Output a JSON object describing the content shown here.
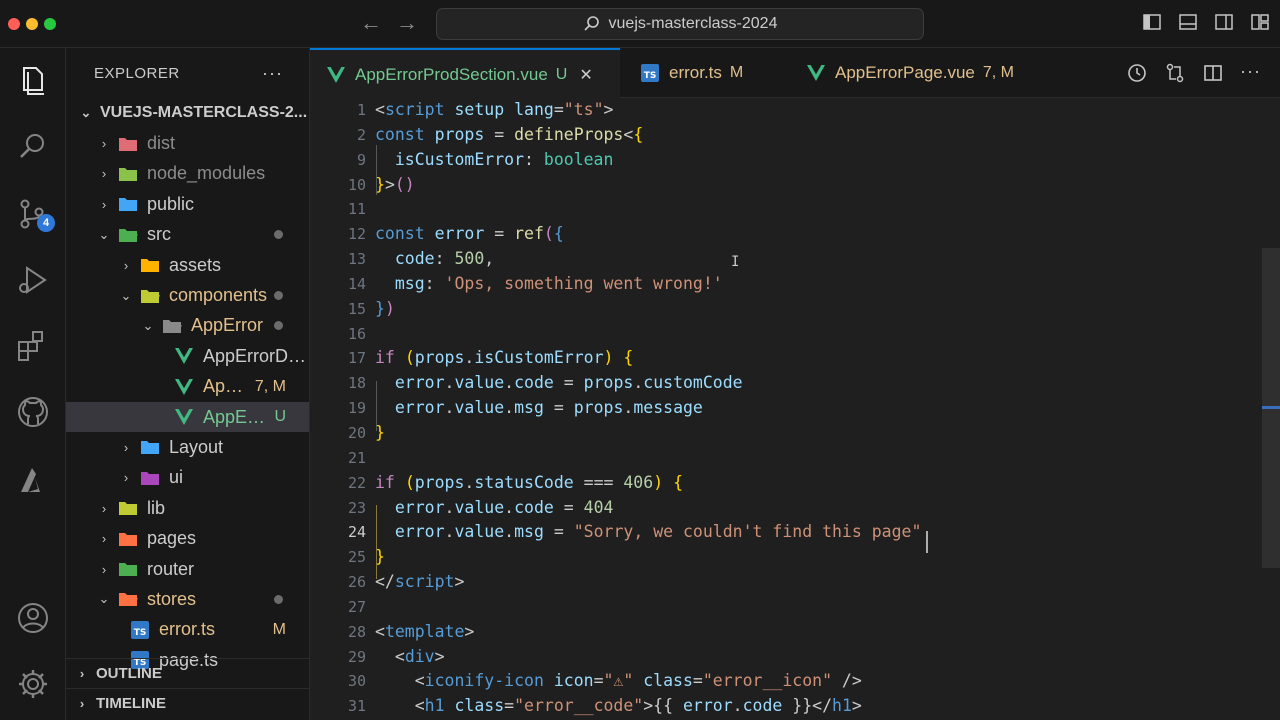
{
  "window": {
    "search_text": "vuejs-masterclass-2024",
    "traffic_colors": [
      "#ff5f57",
      "#febc2e",
      "#28c840"
    ]
  },
  "activity_bar": {
    "items": [
      "explorer-icon",
      "search-icon",
      "source-control-icon",
      "run-debug-icon",
      "extensions-icon",
      "github-icon",
      "azure-icon"
    ],
    "source_control_badge": "4",
    "bottom": [
      "account-icon",
      "settings-gear-icon"
    ]
  },
  "sidebar": {
    "title": "EXPLORER",
    "more": "···",
    "root": "VUEJS-MASTERCLASS-2...",
    "items": [
      {
        "label": "dist",
        "depth": 1,
        "kind": "folder",
        "open": false,
        "color": "#e06c75",
        "dim": true
      },
      {
        "label": "node_modules",
        "depth": 1,
        "kind": "folder",
        "open": false,
        "color": "#8bc34a",
        "dim": true
      },
      {
        "label": "public",
        "depth": 1,
        "kind": "folder",
        "open": false,
        "color": "#42a5f5"
      },
      {
        "label": "src",
        "depth": 1,
        "kind": "folder",
        "open": true,
        "color": "#4caf50",
        "dot": true
      },
      {
        "label": "assets",
        "depth": 2,
        "kind": "folder",
        "open": false,
        "color": "#ffb300"
      },
      {
        "label": "components",
        "depth": 2,
        "kind": "folder",
        "open": true,
        "color": "#c0ca33",
        "dot": true,
        "accent": "#e2c08d"
      },
      {
        "label": "AppError",
        "depth": 3,
        "kind": "folder",
        "open": true,
        "color": "#8a8a8a",
        "dot": true,
        "accent": "#e2c08d"
      },
      {
        "label": "AppErrorDev...",
        "depth": 4,
        "kind": "vue"
      },
      {
        "label": "AppEr...",
        "depth": 4,
        "kind": "vue",
        "deco": "7, M",
        "accent": "#e2c08d"
      },
      {
        "label": "AppError...",
        "depth": 4,
        "kind": "vue",
        "deco": "U",
        "accent": "#73c991",
        "selected": true
      },
      {
        "label": "Layout",
        "depth": 2,
        "kind": "folder",
        "open": false,
        "color": "#42a5f5"
      },
      {
        "label": "ui",
        "depth": 2,
        "kind": "folder",
        "open": false,
        "color": "#ab47bc"
      },
      {
        "label": "lib",
        "depth": 1,
        "kind": "folder",
        "open": false,
        "color": "#c0ca33"
      },
      {
        "label": "pages",
        "depth": 1,
        "kind": "folder",
        "open": false,
        "color": "#ff7043"
      },
      {
        "label": "router",
        "depth": 1,
        "kind": "folder",
        "open": false,
        "color": "#4caf50"
      },
      {
        "label": "stores",
        "depth": 1,
        "kind": "folder",
        "open": true,
        "color": "#ff7043",
        "dot": true,
        "accent": "#e2c08d"
      },
      {
        "label": "error.ts",
        "depth": 2,
        "kind": "ts",
        "deco": "M",
        "accent": "#e2c08d"
      },
      {
        "label": "page.ts",
        "depth": 2,
        "kind": "ts"
      }
    ],
    "sections": [
      "OUTLINE",
      "TIMELINE"
    ]
  },
  "tabs": [
    {
      "label": "AppErrorProdSection.vue",
      "kind": "vue",
      "deco": "U",
      "deco_color": "#73c991",
      "active": true,
      "close": "✕"
    },
    {
      "label": "error.ts",
      "kind": "ts",
      "deco": "M",
      "deco_color": "#e2c08d"
    },
    {
      "label": "AppErrorPage.vue",
      "kind": "vue",
      "deco": "7, M",
      "deco_color": "#e2c08d"
    }
  ],
  "editor": {
    "current_line": "24",
    "lines": [
      {
        "n": "1",
        "tokens": [
          [
            "t-punc",
            "<"
          ],
          [
            "t-tag",
            "script"
          ],
          [
            "t-attr",
            " setup"
          ],
          [
            "t-attr",
            " lang"
          ],
          [
            "t-punc",
            "="
          ],
          [
            "t-str",
            "\"ts\""
          ],
          [
            "t-punc",
            ">"
          ]
        ]
      },
      {
        "n": "2",
        "tokens": [
          [
            "t-decl",
            "const"
          ],
          [
            "t-var",
            " props"
          ],
          [
            "t-punc",
            " = "
          ],
          [
            "t-fn",
            "defineProps"
          ],
          [
            "t-punc",
            "<"
          ],
          [
            "t-br",
            "{"
          ]
        ]
      },
      {
        "n": "9",
        "tokens": [
          [
            "t-var",
            "  isCustomError"
          ],
          [
            "t-punc",
            ": "
          ],
          [
            "t-type",
            "boolean"
          ]
        ]
      },
      {
        "n": "10",
        "tokens": [
          [
            "t-br",
            "}"
          ],
          [
            "t-punc",
            ">"
          ],
          [
            "t-kw",
            "()"
          ]
        ]
      },
      {
        "n": "11",
        "tokens": []
      },
      {
        "n": "12",
        "tokens": [
          [
            "t-decl",
            "const"
          ],
          [
            "t-var",
            " error"
          ],
          [
            "t-punc",
            " = "
          ],
          [
            "t-fn",
            "ref"
          ],
          [
            "t-kw",
            "("
          ],
          [
            "t-decl",
            "{"
          ]
        ]
      },
      {
        "n": "13",
        "tokens": [
          [
            "t-prop",
            "  code"
          ],
          [
            "t-punc",
            ": "
          ],
          [
            "t-num",
            "500"
          ],
          [
            "t-punc",
            ","
          ]
        ]
      },
      {
        "n": "14",
        "tokens": [
          [
            "t-prop",
            "  msg"
          ],
          [
            "t-punc",
            ": "
          ],
          [
            "t-str",
            "'Ops, something went wrong!'"
          ]
        ]
      },
      {
        "n": "15",
        "tokens": [
          [
            "t-decl",
            "}"
          ],
          [
            "t-kw",
            ")"
          ]
        ]
      },
      {
        "n": "16",
        "tokens": []
      },
      {
        "n": "17",
        "tokens": [
          [
            "t-kw",
            "if"
          ],
          [
            "t-punc",
            " "
          ],
          [
            "t-br",
            "("
          ],
          [
            "t-var",
            "props"
          ],
          [
            "t-punc",
            "."
          ],
          [
            "t-var",
            "isCustomError"
          ],
          [
            "t-br",
            ")"
          ],
          [
            "t-punc",
            " "
          ],
          [
            "t-br",
            "{"
          ]
        ]
      },
      {
        "n": "18",
        "tokens": [
          [
            "t-var",
            "  error"
          ],
          [
            "t-punc",
            "."
          ],
          [
            "t-prop",
            "value"
          ],
          [
            "t-punc",
            "."
          ],
          [
            "t-prop",
            "code"
          ],
          [
            "t-punc",
            " = "
          ],
          [
            "t-var",
            "props"
          ],
          [
            "t-punc",
            "."
          ],
          [
            "t-prop",
            "customCode"
          ]
        ]
      },
      {
        "n": "19",
        "tokens": [
          [
            "t-var",
            "  error"
          ],
          [
            "t-punc",
            "."
          ],
          [
            "t-prop",
            "value"
          ],
          [
            "t-punc",
            "."
          ],
          [
            "t-prop",
            "msg"
          ],
          [
            "t-punc",
            " = "
          ],
          [
            "t-var",
            "props"
          ],
          [
            "t-punc",
            "."
          ],
          [
            "t-prop",
            "message"
          ]
        ]
      },
      {
        "n": "20",
        "tokens": [
          [
            "t-br",
            "}"
          ]
        ]
      },
      {
        "n": "21",
        "tokens": []
      },
      {
        "n": "22",
        "tokens": [
          [
            "t-kw",
            "if"
          ],
          [
            "t-punc",
            " "
          ],
          [
            "t-br",
            "("
          ],
          [
            "t-var",
            "props"
          ],
          [
            "t-punc",
            "."
          ],
          [
            "t-prop",
            "statusCode"
          ],
          [
            "t-punc",
            " === "
          ],
          [
            "t-num",
            "406"
          ],
          [
            "t-br",
            ")"
          ],
          [
            "t-punc",
            " "
          ],
          [
            "t-br",
            "{"
          ]
        ]
      },
      {
        "n": "23",
        "tokens": [
          [
            "t-var",
            "  error"
          ],
          [
            "t-punc",
            "."
          ],
          [
            "t-prop",
            "value"
          ],
          [
            "t-punc",
            "."
          ],
          [
            "t-prop",
            "code"
          ],
          [
            "t-punc",
            " = "
          ],
          [
            "t-num",
            "404"
          ]
        ]
      },
      {
        "n": "24",
        "tokens": [
          [
            "t-var",
            "  error"
          ],
          [
            "t-punc",
            "."
          ],
          [
            "t-prop",
            "value"
          ],
          [
            "t-punc",
            "."
          ],
          [
            "t-prop",
            "msg"
          ],
          [
            "t-punc",
            " = "
          ],
          [
            "t-str",
            "\"Sorry, we couldn't find this page\""
          ]
        ]
      },
      {
        "n": "25",
        "tokens": [
          [
            "t-br",
            "}"
          ]
        ]
      },
      {
        "n": "26",
        "tokens": [
          [
            "t-punc",
            "</"
          ],
          [
            "t-tag",
            "script"
          ],
          [
            "t-punc",
            ">"
          ]
        ]
      },
      {
        "n": "27",
        "tokens": []
      },
      {
        "n": "28",
        "tokens": [
          [
            "t-punc",
            "<"
          ],
          [
            "t-tag",
            "template"
          ],
          [
            "t-punc",
            ">"
          ]
        ]
      },
      {
        "n": "29",
        "tokens": [
          [
            "t-punc",
            "  <"
          ],
          [
            "t-tag",
            "div"
          ],
          [
            "t-punc",
            ">"
          ]
        ]
      },
      {
        "n": "30",
        "tokens": [
          [
            "t-punc",
            "    <"
          ],
          [
            "t-tag",
            "iconify-icon"
          ],
          [
            "t-attr",
            " icon"
          ],
          [
            "t-punc",
            "="
          ],
          [
            "t-str",
            "\"⚠\""
          ],
          [
            "t-attr",
            " class"
          ],
          [
            "t-punc",
            "="
          ],
          [
            "t-str",
            "\"error__icon\""
          ],
          [
            "t-punc",
            " />"
          ]
        ]
      },
      {
        "n": "31",
        "tokens": [
          [
            "t-punc",
            "    <"
          ],
          [
            "t-tag",
            "h1"
          ],
          [
            "t-attr",
            " class"
          ],
          [
            "t-punc",
            "="
          ],
          [
            "t-str",
            "\"error__code\""
          ],
          [
            "t-punc",
            ">{{ "
          ],
          [
            "t-var",
            "error"
          ],
          [
            "t-punc",
            "."
          ],
          [
            "t-prop",
            "code"
          ],
          [
            "t-punc",
            " }}</"
          ],
          [
            "t-tag",
            "h1"
          ],
          [
            "t-punc",
            ">"
          ]
        ]
      }
    ]
  }
}
